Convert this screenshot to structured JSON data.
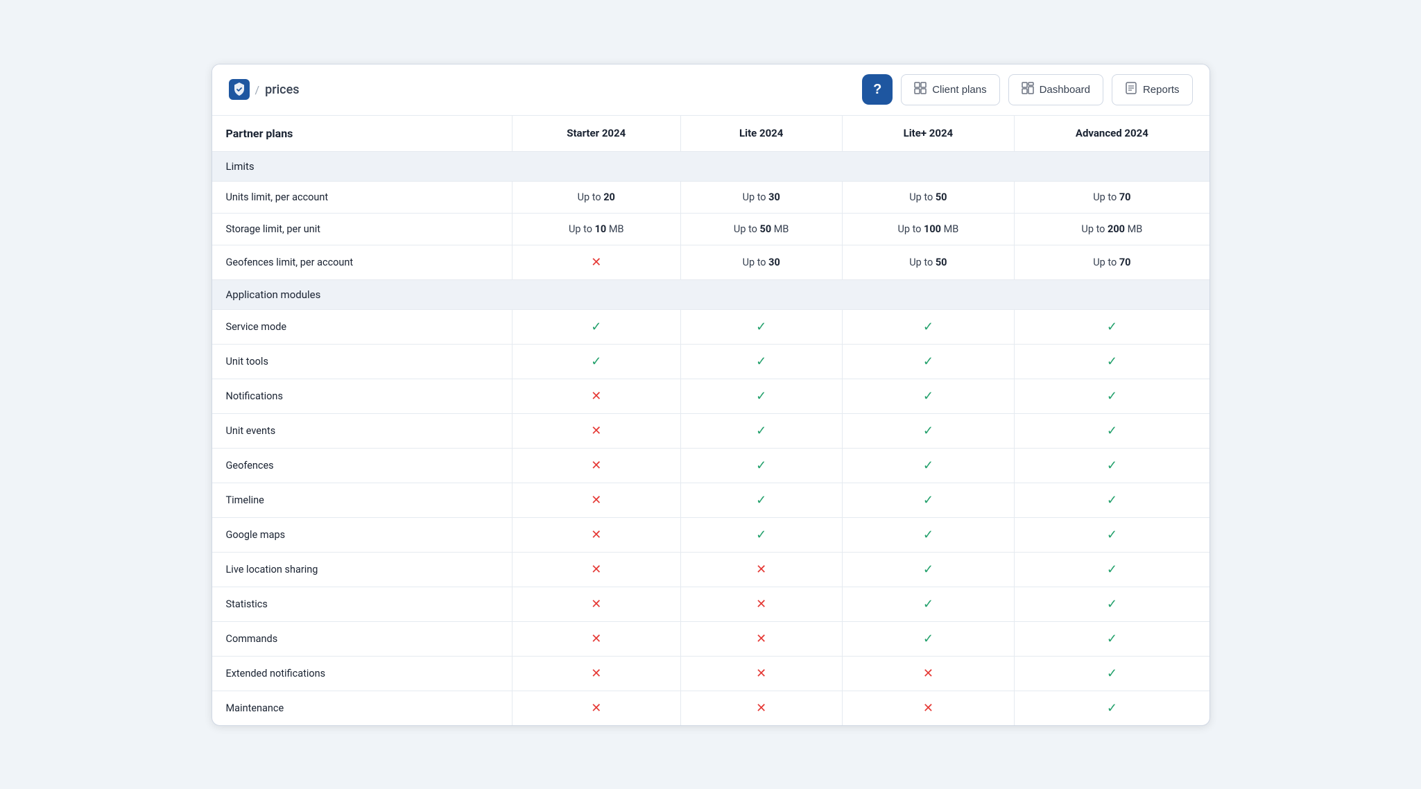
{
  "header": {
    "brand_icon_label": "brand-shield-icon",
    "breadcrumb_separator": "/",
    "breadcrumb_page": "prices",
    "help_button_label": "?",
    "nav_buttons": [
      {
        "id": "client-plans",
        "icon": "⊞",
        "label": "Client plans"
      },
      {
        "id": "dashboard",
        "icon": "⊟",
        "label": "Dashboard"
      },
      {
        "id": "reports",
        "icon": "⊠",
        "label": "Reports"
      }
    ]
  },
  "table": {
    "columns": [
      {
        "id": "feature",
        "label": "Partner plans"
      },
      {
        "id": "starter",
        "label": "Starter 2024"
      },
      {
        "id": "lite",
        "label": "Lite 2024"
      },
      {
        "id": "litePlus",
        "label": "Lite+ 2024"
      },
      {
        "id": "advanced",
        "label": "Advanced 2024"
      }
    ],
    "sections": [
      {
        "id": "limits",
        "label": "Limits",
        "rows": [
          {
            "feature": "Units limit, per account",
            "starter": {
              "type": "text",
              "prefix": "Up to ",
              "value": "20"
            },
            "lite": {
              "type": "text",
              "prefix": "Up to ",
              "value": "30"
            },
            "litePlus": {
              "type": "text",
              "prefix": "Up to ",
              "value": "50"
            },
            "advanced": {
              "type": "text",
              "prefix": "Up to ",
              "value": "70"
            }
          },
          {
            "feature": "Storage limit, per unit",
            "starter": {
              "type": "text",
              "prefix": "Up to ",
              "value": "10",
              "suffix": " MB"
            },
            "lite": {
              "type": "text",
              "prefix": "Up to ",
              "value": "50",
              "suffix": " MB"
            },
            "litePlus": {
              "type": "text",
              "prefix": "Up to ",
              "value": "100",
              "suffix": " MB"
            },
            "advanced": {
              "type": "text",
              "prefix": "Up to ",
              "value": "200",
              "suffix": " MB"
            }
          },
          {
            "feature": "Geofences limit, per account",
            "starter": {
              "type": "cross"
            },
            "lite": {
              "type": "text",
              "prefix": "Up to ",
              "value": "30"
            },
            "litePlus": {
              "type": "text",
              "prefix": "Up to ",
              "value": "50"
            },
            "advanced": {
              "type": "text",
              "prefix": "Up to ",
              "value": "70"
            }
          }
        ]
      },
      {
        "id": "application-modules",
        "label": "Application modules",
        "rows": [
          {
            "feature": "Service mode",
            "starter": {
              "type": "check"
            },
            "lite": {
              "type": "check"
            },
            "litePlus": {
              "type": "check"
            },
            "advanced": {
              "type": "check"
            }
          },
          {
            "feature": "Unit tools",
            "starter": {
              "type": "check"
            },
            "lite": {
              "type": "check"
            },
            "litePlus": {
              "type": "check"
            },
            "advanced": {
              "type": "check"
            }
          },
          {
            "feature": "Notifications",
            "starter": {
              "type": "cross"
            },
            "lite": {
              "type": "check"
            },
            "litePlus": {
              "type": "check"
            },
            "advanced": {
              "type": "check"
            }
          },
          {
            "feature": "Unit events",
            "starter": {
              "type": "cross"
            },
            "lite": {
              "type": "check"
            },
            "litePlus": {
              "type": "check"
            },
            "advanced": {
              "type": "check"
            }
          },
          {
            "feature": "Geofences",
            "starter": {
              "type": "cross"
            },
            "lite": {
              "type": "check"
            },
            "litePlus": {
              "type": "check"
            },
            "advanced": {
              "type": "check"
            }
          },
          {
            "feature": "Timeline",
            "starter": {
              "type": "cross"
            },
            "lite": {
              "type": "check"
            },
            "litePlus": {
              "type": "check"
            },
            "advanced": {
              "type": "check"
            }
          },
          {
            "feature": "Google maps",
            "starter": {
              "type": "cross"
            },
            "lite": {
              "type": "check"
            },
            "litePlus": {
              "type": "check"
            },
            "advanced": {
              "type": "check"
            }
          },
          {
            "feature": "Live location sharing",
            "starter": {
              "type": "cross"
            },
            "lite": {
              "type": "cross"
            },
            "litePlus": {
              "type": "check"
            },
            "advanced": {
              "type": "check"
            }
          },
          {
            "feature": "Statistics",
            "starter": {
              "type": "cross"
            },
            "lite": {
              "type": "cross"
            },
            "litePlus": {
              "type": "check"
            },
            "advanced": {
              "type": "check"
            }
          },
          {
            "feature": "Commands",
            "starter": {
              "type": "cross"
            },
            "lite": {
              "type": "cross"
            },
            "litePlus": {
              "type": "check"
            },
            "advanced": {
              "type": "check"
            }
          },
          {
            "feature": "Extended notifications",
            "starter": {
              "type": "cross"
            },
            "lite": {
              "type": "cross"
            },
            "litePlus": {
              "type": "cross"
            },
            "advanced": {
              "type": "check"
            }
          },
          {
            "feature": "Maintenance",
            "starter": {
              "type": "cross"
            },
            "lite": {
              "type": "cross"
            },
            "litePlus": {
              "type": "cross"
            },
            "advanced": {
              "type": "check"
            }
          }
        ]
      }
    ]
  }
}
